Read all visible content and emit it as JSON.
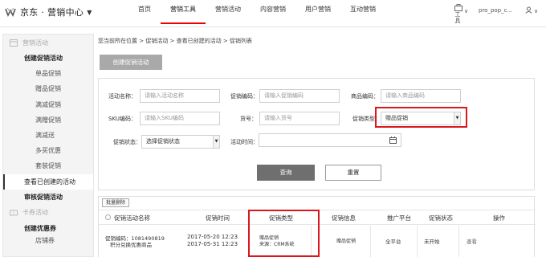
{
  "header": {
    "app_title": "京东 · 营销中心",
    "nav": [
      "首页",
      "营销工具",
      "营销活动",
      "内容营销",
      "用户营销",
      "互动营销"
    ],
    "active_nav": 1,
    "tools_label": "工具",
    "username": "pro_pop_c..."
  },
  "sidebar": {
    "group1": "营销活动",
    "items": [
      {
        "label": "创建促销活动",
        "level": 1
      },
      {
        "label": "单品促销",
        "level": 2
      },
      {
        "label": "赠品促销",
        "level": 2
      },
      {
        "label": "满减促销",
        "level": 2
      },
      {
        "label": "满赠促销",
        "level": 2
      },
      {
        "label": "满减送",
        "level": 2
      },
      {
        "label": "多买优惠",
        "level": 2
      },
      {
        "label": "套装促销",
        "level": 2
      },
      {
        "label": "查看已创建的活动",
        "level": 1,
        "selected": true
      },
      {
        "label": "审核促销活动",
        "level": 1
      }
    ],
    "group2": "卡券活动",
    "items2": [
      {
        "label": "创建优惠券",
        "level": 1
      },
      {
        "label": "店铺券",
        "level": 2
      }
    ]
  },
  "breadcrumb": "您当前所在位置 > 促销活动 > 查看已创建的活动 > 促销列表",
  "create_button": "创建促销活动",
  "filters": {
    "activity_name_label": "活动名称：",
    "activity_name_placeholder": "请输入活动名称",
    "promo_code_label": "促销编码：",
    "promo_code_placeholder": "请输入促销编码",
    "product_code_label": "商品编码：",
    "product_code_placeholder": "请输入商品编码",
    "sku_label": "SKU编码：",
    "sku_placeholder": "请输入SKU编码",
    "item_no_label": "货号：",
    "item_no_placeholder": "请输入货号",
    "promo_type_label": "促销类型：",
    "promo_type_value": "赠品促销",
    "promo_status_label": "促销状态：",
    "promo_status_value": "选择促销状态",
    "activity_time_label": "活动时间："
  },
  "buttons": {
    "query": "查询",
    "reset": "重置",
    "batch_delete": "批量删除"
  },
  "table": {
    "headers": [
      "促销活动名称",
      "促销时间",
      "促销类型",
      "促销信息",
      "推广平台",
      "促销状态",
      "操作"
    ],
    "rows": [
      {
        "code": "促销编码：1081490819",
        "name": "积分兑换优惠商品",
        "time_start": "2017-05-20 12:23",
        "time_end": "2017-05-31 12:23",
        "type_line1": "赠品促销",
        "type_line2": "来源：CRM系统",
        "info": "赠品促销",
        "platform": "全平台",
        "status": "未开始",
        "action": "查看"
      }
    ]
  }
}
